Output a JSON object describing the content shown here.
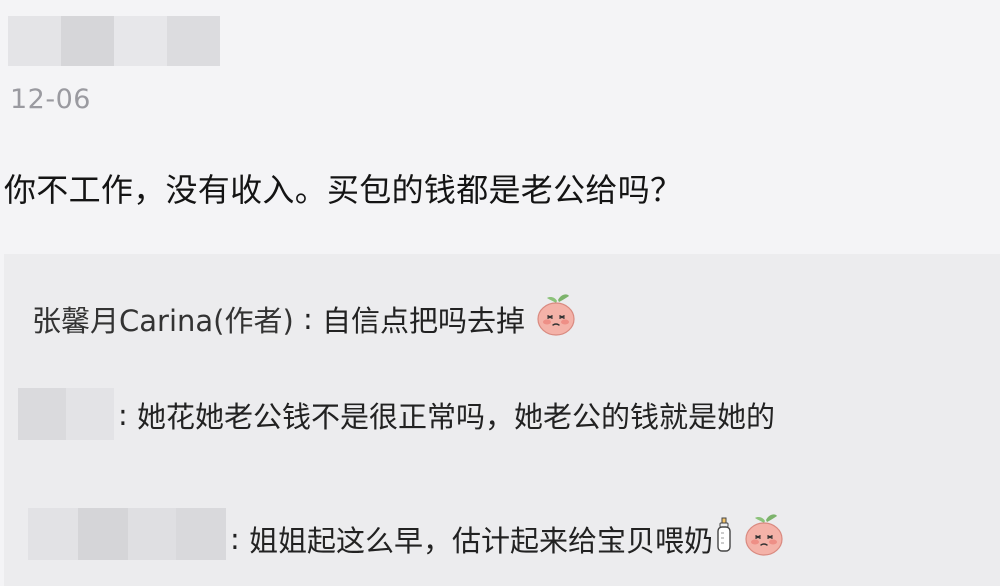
{
  "comment": {
    "timestamp": "12-06",
    "text": "你不工作，没有收入。买包的钱都是老公给吗？"
  },
  "replies": [
    {
      "author": "张馨月Carina(作者)",
      "separator": " : ",
      "text": "自信点把吗去掉",
      "emoji": "peach-face-emoji"
    },
    {
      "author": "",
      "separator": ": ",
      "text": "她花她老公钱不是很正常吗，她老公的钱就是她的"
    },
    {
      "author": "",
      "separator": ": ",
      "text": "姐姐起这么早，估计起来给宝贝喂奶",
      "emoji": "peach-face-emoji",
      "extra_icon": "baby-bottle-icon"
    }
  ],
  "colors": {
    "background": "#f4f4f6",
    "reply_panel": "#ececee",
    "timestamp": "#9a9aa0",
    "emoji_pink": "#f2a7a0"
  }
}
